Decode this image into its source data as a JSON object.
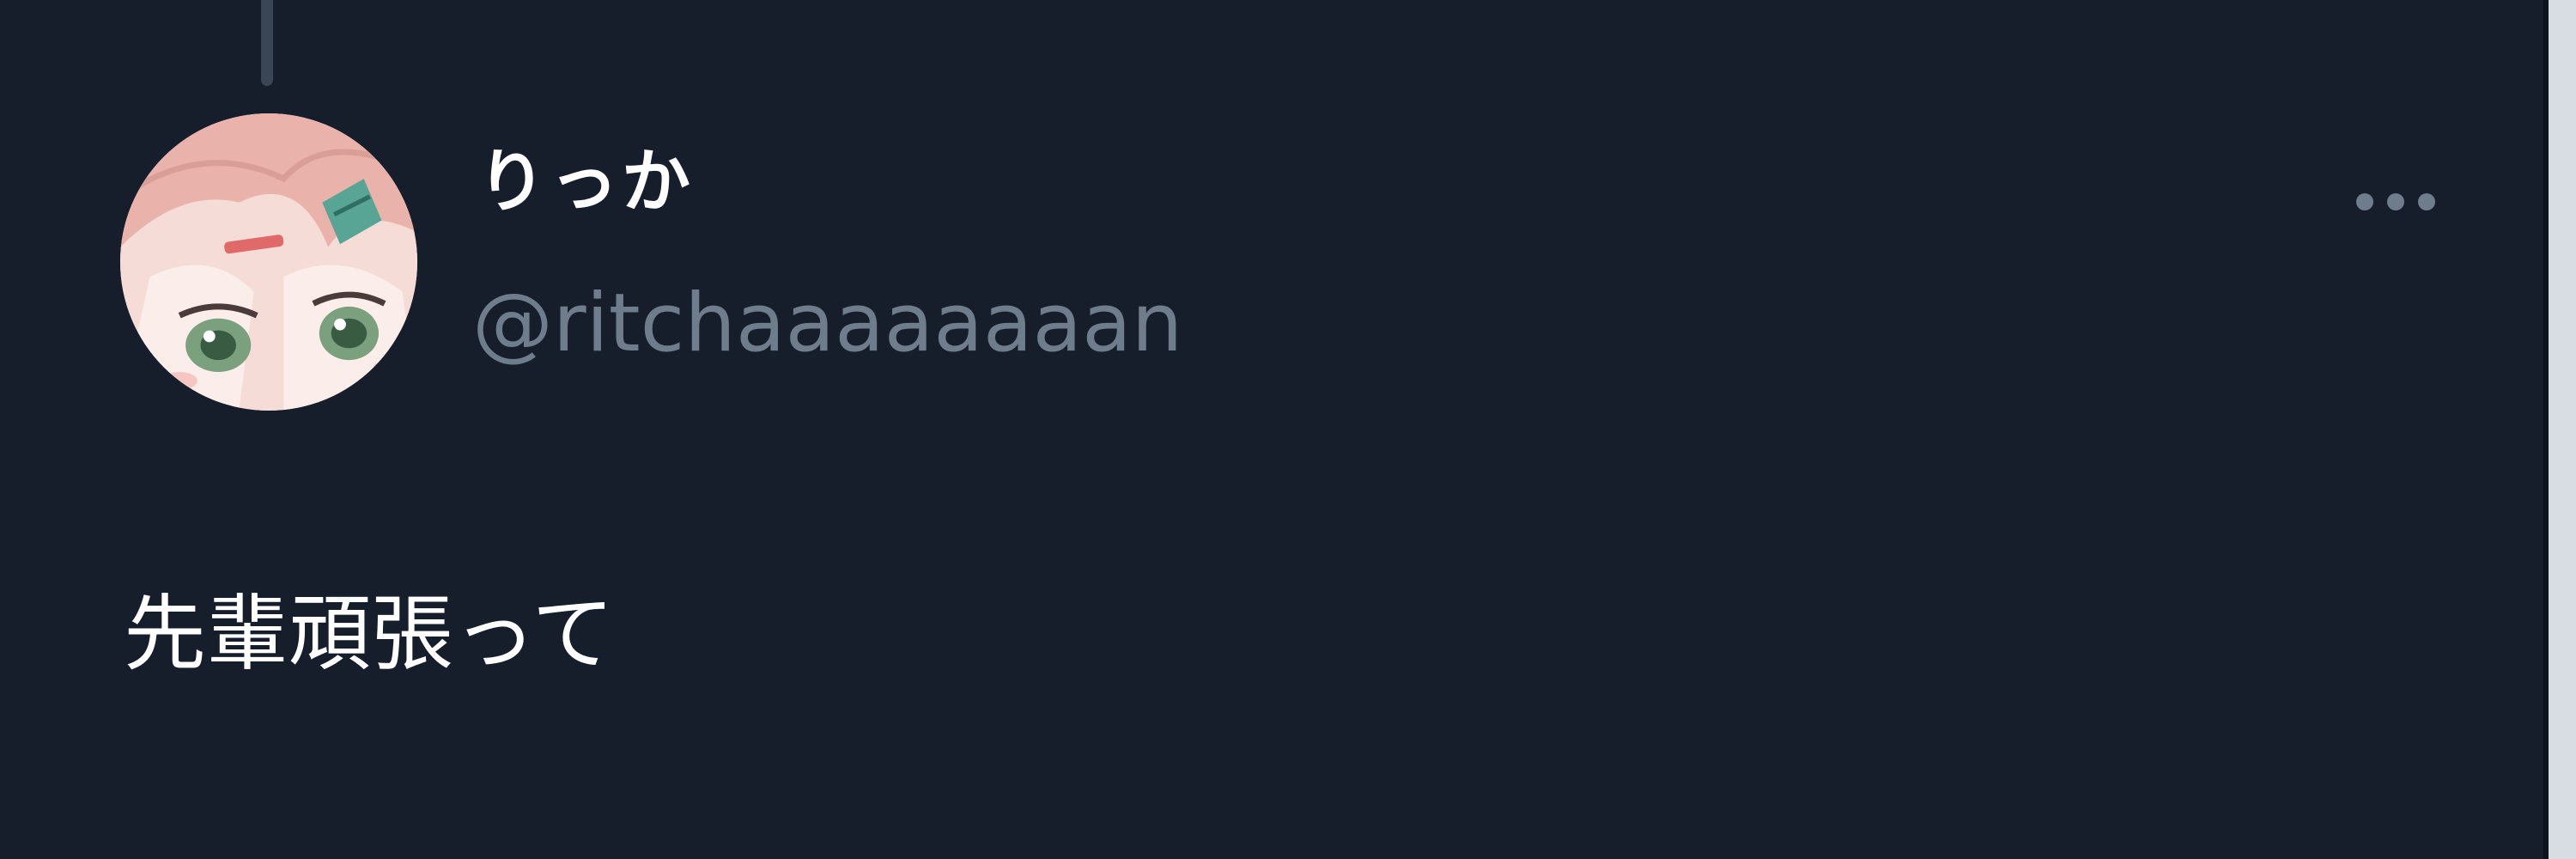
{
  "tweet": {
    "display_name": "りっか",
    "handle": "@ritchaaaaaaaan",
    "text": "先輩頑張って",
    "avatar_alt": "",
    "more_icon": "more-horizontal-icon"
  },
  "colors": {
    "background": "#161e2b",
    "primary_text": "#ffffff",
    "secondary_text": "#6f7c8c",
    "thread_line": "#3a4656"
  }
}
